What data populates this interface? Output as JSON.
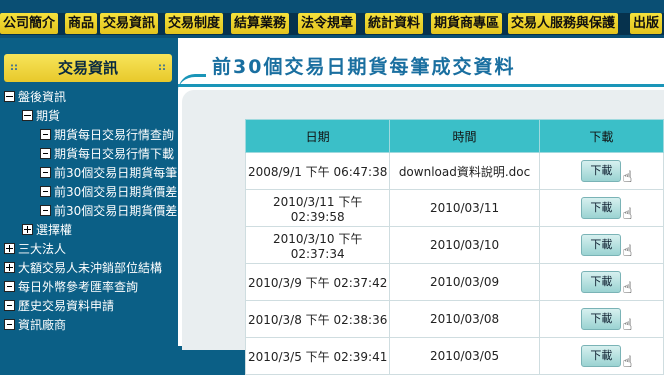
{
  "nav": {
    "items": [
      "公司簡介",
      "商品",
      "交易資訊",
      "交易制度",
      "結算業務",
      "法令規章",
      "統計資料",
      "期貨商專區",
      "交易人服務與保護",
      "出版"
    ]
  },
  "sidebar": {
    "header": "交易資訊",
    "header_dots": "::",
    "tree": [
      {
        "label": "盤後資訊",
        "kind": "minus"
      },
      {
        "label": "期貨",
        "kind": "minus"
      },
      {
        "label": "期貨每日交易行情查詢",
        "kind": "leaf"
      },
      {
        "label": "期貨每日交易行情下載",
        "kind": "leaf"
      },
      {
        "label": "前30個交易日期貨每筆",
        "kind": "leaf"
      },
      {
        "label": "前30個交易日期貨價差",
        "kind": "leaf"
      },
      {
        "label": "前30個交易日期貨價差",
        "kind": "leaf"
      },
      {
        "label": "選擇權",
        "kind": "plus"
      },
      {
        "label": "三大法人",
        "kind": "plus"
      },
      {
        "label": "大額交易人未沖銷部位結構",
        "kind": "plus"
      },
      {
        "label": "每日外幣參考匯率查詢",
        "kind": "leaf"
      },
      {
        "label": "歷史交易資料申請",
        "kind": "leaf"
      },
      {
        "label": "資訊廠商",
        "kind": "leaf"
      }
    ]
  },
  "main": {
    "title": "前30個交易日期貨每筆成交資料",
    "table": {
      "headers": [
        "日期",
        "時間",
        "下載"
      ],
      "rows": [
        {
          "date": "2008/9/1 下午 06:47:38",
          "time": "download資料說明.doc",
          "btn": "下載"
        },
        {
          "date": "2010/3/11 下午 02:39:58",
          "time": "2010/03/11",
          "btn": "下載"
        },
        {
          "date": "2010/3/10 下午 02:37:34",
          "time": "2010/03/10",
          "btn": "下載"
        },
        {
          "date": "2010/3/9 下午 02:37:42",
          "time": "2010/03/09",
          "btn": "下載"
        },
        {
          "date": "2010/3/8 下午 02:38:36",
          "time": "2010/03/08",
          "btn": "下載"
        },
        {
          "date": "2010/3/5 下午 02:39:41",
          "time": "2010/03/05",
          "btn": "下載"
        }
      ]
    }
  },
  "colors": {
    "nav_bg": "#0a4f74",
    "nav_btn": "#f6e23d",
    "sidebar_bg": "#0b5f86",
    "table_head": "#3bbfc8",
    "title": "#1a6fa0"
  }
}
